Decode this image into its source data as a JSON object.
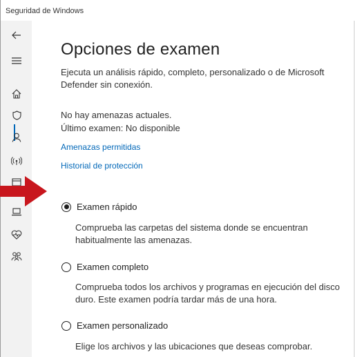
{
  "window": {
    "title": "Seguridad de Windows"
  },
  "sidebar": {
    "items": [
      {
        "name": "back-icon"
      },
      {
        "name": "menu-icon"
      },
      {
        "name": "home-icon"
      },
      {
        "name": "shield-icon",
        "active": true
      },
      {
        "name": "account-icon"
      },
      {
        "name": "network-icon"
      },
      {
        "name": "app-browser-icon"
      },
      {
        "name": "device-icon"
      },
      {
        "name": "health-icon"
      },
      {
        "name": "family-icon"
      }
    ]
  },
  "main": {
    "heading": "Opciones de examen",
    "description": "Ejecuta un análisis rápido, completo, personalizado o de Microsoft Defender sin conexión.",
    "status_threats": "No hay amenazas actuales.",
    "status_last_scan": "Último examen: No disponible",
    "link_allowed": "Amenazas permitidas",
    "link_history": "Historial de protección",
    "options": [
      {
        "label": "Examen rápido",
        "description": "Comprueba las carpetas del sistema donde se encuentran habitualmente las amenazas.",
        "selected": true
      },
      {
        "label": "Examen completo",
        "description": "Comprueba todos los archivos y programas en ejecución del disco duro. Este examen podría tardar más de una hora.",
        "selected": false
      },
      {
        "label": "Examen personalizado",
        "description": "Elige los archivos y las ubicaciones que deseas comprobar.",
        "selected": false
      }
    ]
  },
  "colors": {
    "accent": "#0067b8",
    "arrow": "#c8161d",
    "sidebar_bg": "#f2f2f2"
  }
}
